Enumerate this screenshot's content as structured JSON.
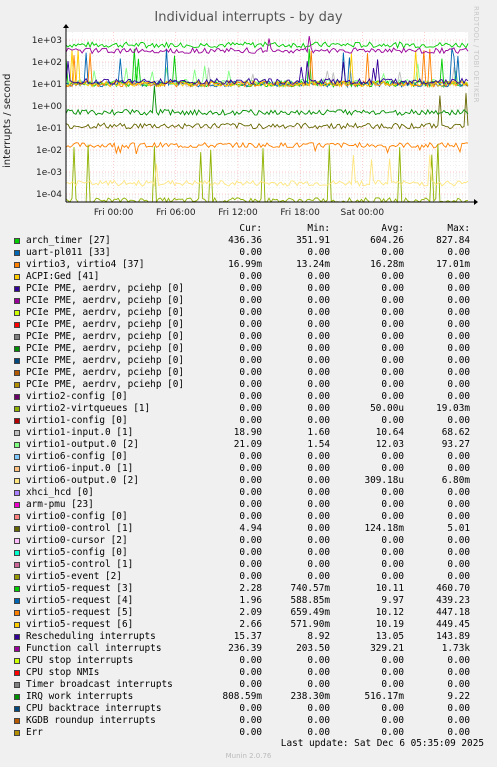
{
  "title": "Individual interrupts - by day",
  "ylabel": "interrupts / second",
  "watermark": "RRDTOOL / TOBI OETIKER",
  "footer": {
    "last_update": "Last update: Sat Dec  6 05:35:09 2025",
    "version": "Munin 2.0.76"
  },
  "columns": {
    "cur": "Cur:",
    "min": "Min:",
    "avg": "Avg:",
    "max": "Max:"
  },
  "chart_data": {
    "type": "line",
    "title": "Individual interrupts - by day",
    "ylabel": "interrupts / second",
    "yscale": "log",
    "ylim": [
      5e-05,
      2000
    ],
    "yticks": [
      "1e+03",
      "1e+02",
      "1e+01",
      "1e+00",
      "1e-01",
      "1e-02",
      "1e-03",
      "1e-04"
    ],
    "xticks": [
      "Fri 00:00",
      "Fri 06:00",
      "Fri 12:00",
      "Fri 18:00",
      "Sat 00:00"
    ],
    "grid": true,
    "series": [
      {
        "name": "arch_timer [27]",
        "color": "#00cc00",
        "cur": "436.36",
        "min": "351.91",
        "avg": "604.26",
        "max": "827.84"
      },
      {
        "name": "uart-pl011 [33]",
        "color": "#0066b3",
        "cur": "0.00",
        "min": "0.00",
        "avg": "0.00",
        "max": "0.00"
      },
      {
        "name": "virtio3, virtio4 [37]",
        "color": "#ff8000",
        "cur": "16.99m",
        "min": "13.24m",
        "avg": "16.28m",
        "max": "17.01m"
      },
      {
        "name": "ACPI:Ged [41]",
        "color": "#ffcc00",
        "cur": "0.00",
        "min": "0.00",
        "avg": "0.00",
        "max": "0.00"
      },
      {
        "name": "PCIe PME, aerdrv, pciehp [0]",
        "color": "#330099",
        "cur": "0.00",
        "min": "0.00",
        "avg": "0.00",
        "max": "0.00"
      },
      {
        "name": "PCIe PME, aerdrv, pciehp [0]",
        "color": "#990099",
        "cur": "0.00",
        "min": "0.00",
        "avg": "0.00",
        "max": "0.00"
      },
      {
        "name": "PCIe PME, aerdrv, pciehp [0]",
        "color": "#ccff00",
        "cur": "0.00",
        "min": "0.00",
        "avg": "0.00",
        "max": "0.00"
      },
      {
        "name": "PCIe PME, aerdrv, pciehp [0]",
        "color": "#ff0000",
        "cur": "0.00",
        "min": "0.00",
        "avg": "0.00",
        "max": "0.00"
      },
      {
        "name": "PCIe PME, aerdrv, pciehp [0]",
        "color": "#808080",
        "cur": "0.00",
        "min": "0.00",
        "avg": "0.00",
        "max": "0.00"
      },
      {
        "name": "PCIe PME, aerdrv, pciehp [0]",
        "color": "#008f00",
        "cur": "0.00",
        "min": "0.00",
        "avg": "0.00",
        "max": "0.00"
      },
      {
        "name": "PCIe PME, aerdrv, pciehp [0]",
        "color": "#00487d",
        "cur": "0.00",
        "min": "0.00",
        "avg": "0.00",
        "max": "0.00"
      },
      {
        "name": "PCIe PME, aerdrv, pciehp [0]",
        "color": "#b35a00",
        "cur": "0.00",
        "min": "0.00",
        "avg": "0.00",
        "max": "0.00"
      },
      {
        "name": "PCIe PME, aerdrv, pciehp [0]",
        "color": "#b38f00",
        "cur": "0.00",
        "min": "0.00",
        "avg": "0.00",
        "max": "0.00"
      },
      {
        "name": "virtio2-config [0]",
        "color": "#6b006b",
        "cur": "0.00",
        "min": "0.00",
        "avg": "0.00",
        "max": "0.00"
      },
      {
        "name": "virtio2-virtqueues [1]",
        "color": "#8fb300",
        "cur": "0.00",
        "min": "0.00",
        "avg": "50.00u",
        "max": "19.03m"
      },
      {
        "name": "virtio1-config [0]",
        "color": "#b30000",
        "cur": "0.00",
        "min": "0.00",
        "avg": "0.00",
        "max": "0.00"
      },
      {
        "name": "virtio1-input.0 [1]",
        "color": "#bebebe",
        "cur": "18.90",
        "min": "1.60",
        "avg": "10.64",
        "max": "68.62"
      },
      {
        "name": "virtio1-output.0 [2]",
        "color": "#80ff80",
        "cur": "21.09",
        "min": "1.54",
        "avg": "12.03",
        "max": "93.27"
      },
      {
        "name": "virtio6-config [0]",
        "color": "#80c9ff",
        "cur": "0.00",
        "min": "0.00",
        "avg": "0.00",
        "max": "0.00"
      },
      {
        "name": "virtio6-input.0 [1]",
        "color": "#ffc080",
        "cur": "0.00",
        "min": "0.00",
        "avg": "0.00",
        "max": "0.00"
      },
      {
        "name": "virtio6-output.0 [2]",
        "color": "#ffe680",
        "cur": "0.00",
        "min": "0.00",
        "avg": "309.18u",
        "max": "6.80m"
      },
      {
        "name": "xhci_hcd [0]",
        "color": "#aa80ff",
        "cur": "0.00",
        "min": "0.00",
        "avg": "0.00",
        "max": "0.00"
      },
      {
        "name": "arm-pmu [23]",
        "color": "#ee00cc",
        "cur": "0.00",
        "min": "0.00",
        "avg": "0.00",
        "max": "0.00"
      },
      {
        "name": "virtio0-config [0]",
        "color": "#ff8080",
        "cur": "0.00",
        "min": "0.00",
        "avg": "0.00",
        "max": "0.00"
      },
      {
        "name": "virtio0-control [1]",
        "color": "#666600",
        "cur": "4.94",
        "min": "0.00",
        "avg": "124.18m",
        "max": "5.01"
      },
      {
        "name": "virtio0-cursor [2]",
        "color": "#ffbfff",
        "cur": "0.00",
        "min": "0.00",
        "avg": "0.00",
        "max": "0.00"
      },
      {
        "name": "virtio5-config [0]",
        "color": "#00ffcc",
        "cur": "0.00",
        "min": "0.00",
        "avg": "0.00",
        "max": "0.00"
      },
      {
        "name": "virtio5-control [1]",
        "color": "#cc6699",
        "cur": "0.00",
        "min": "0.00",
        "avg": "0.00",
        "max": "0.00"
      },
      {
        "name": "virtio5-event [2]",
        "color": "#999900",
        "cur": "0.00",
        "min": "0.00",
        "avg": "0.00",
        "max": "0.00"
      },
      {
        "name": "virtio5-request [3]",
        "color": "#00cc00",
        "cur": "2.28",
        "min": "740.57m",
        "avg": "10.11",
        "max": "460.70"
      },
      {
        "name": "virtio5-request [4]",
        "color": "#0066b3",
        "cur": "1.96",
        "min": "588.85m",
        "avg": "9.97",
        "max": "439.23"
      },
      {
        "name": "virtio5-request [5]",
        "color": "#ff8000",
        "cur": "2.09",
        "min": "659.49m",
        "avg": "10.12",
        "max": "447.18"
      },
      {
        "name": "virtio5-request [6]",
        "color": "#ffcc00",
        "cur": "2.66",
        "min": "571.90m",
        "avg": "10.19",
        "max": "449.45"
      },
      {
        "name": "Rescheduling interrupts",
        "color": "#330099",
        "cur": "15.37",
        "min": "8.92",
        "avg": "13.05",
        "max": "143.89"
      },
      {
        "name": "Function call interrupts",
        "color": "#990099",
        "cur": "236.39",
        "min": "203.50",
        "avg": "329.21",
        "max": "1.73k"
      },
      {
        "name": "CPU stop interrupts",
        "color": "#ccff00",
        "cur": "0.00",
        "min": "0.00",
        "avg": "0.00",
        "max": "0.00"
      },
      {
        "name": "CPU stop NMIs",
        "color": "#ff0000",
        "cur": "0.00",
        "min": "0.00",
        "avg": "0.00",
        "max": "0.00"
      },
      {
        "name": "Timer broadcast interrupts",
        "color": "#808080",
        "cur": "0.00",
        "min": "0.00",
        "avg": "0.00",
        "max": "0.00"
      },
      {
        "name": "IRQ work interrupts",
        "color": "#008f00",
        "cur": "808.59m",
        "min": "238.30m",
        "avg": "516.17m",
        "max": "9.22"
      },
      {
        "name": "CPU backtrace interrupts",
        "color": "#00487d",
        "cur": "0.00",
        "min": "0.00",
        "avg": "0.00",
        "max": "0.00"
      },
      {
        "name": "KGDB roundup interrupts",
        "color": "#b35a00",
        "cur": "0.00",
        "min": "0.00",
        "avg": "0.00",
        "max": "0.00"
      },
      {
        "name": "Err",
        "color": "#b38f00",
        "cur": "0.00",
        "min": "0.00",
        "avg": "0.00",
        "max": "0.00"
      }
    ]
  }
}
